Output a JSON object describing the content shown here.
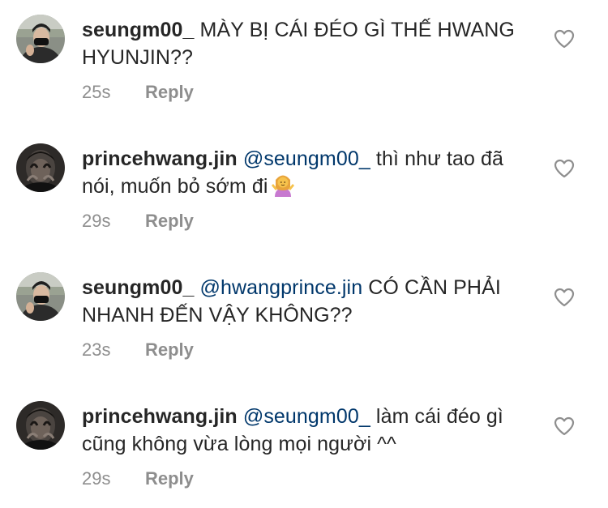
{
  "comments": [
    {
      "username": "seungm00_",
      "mention": "",
      "text": "MÀY BỊ CÁI ĐÉO GÌ THẾ HWANG HYUNJIN??",
      "time": "25s",
      "reply": "Reply",
      "avatar": "avatar-seungm00"
    },
    {
      "username": "princehwang.jin",
      "mention": "@seungm00_",
      "text": "thì như tao đã nói, muốn bỏ sớm đi",
      "emoji": "person-shrugging-emoji",
      "time": "29s",
      "reply": "Reply",
      "avatar": "avatar-princehwang"
    },
    {
      "username": "seungm00_",
      "mention": "@hwangprince.jin",
      "text": "CÓ CẦN PHẢI NHANH ĐẾN VẬY KHÔNG??",
      "time": "23s",
      "reply": "Reply",
      "avatar": "avatar-seungm00"
    },
    {
      "username": "princehwang.jin",
      "mention": "@seungm00_",
      "text": "làm cái đéo gì cũng không vừa lòng mọi người ^^",
      "time": "29s",
      "reply": "Reply",
      "avatar": "avatar-princehwang"
    }
  ],
  "icons": {
    "like": "heart-outline-icon"
  },
  "colors": {
    "text": "#262626",
    "mention": "#00376b",
    "meta": "#8e8e8e"
  }
}
